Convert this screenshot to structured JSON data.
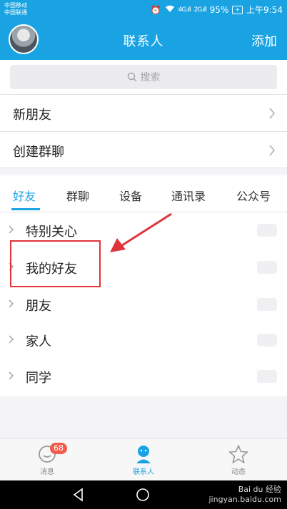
{
  "status_bar": {
    "carrier_1": "中国移动",
    "carrier_2": "中国联通",
    "signal_1": "4G.ıll",
    "signal_2": "2G.ıll",
    "battery": "95%",
    "time": "上午9:54"
  },
  "header": {
    "title": "联系人",
    "add_label": "添加"
  },
  "search": {
    "placeholder": "搜索"
  },
  "rows": [
    {
      "label": "新朋友"
    },
    {
      "label": "创建群聊"
    }
  ],
  "tabs": [
    {
      "label": "好友",
      "active": true
    },
    {
      "label": "群聊"
    },
    {
      "label": "设备"
    },
    {
      "label": "通讯录"
    },
    {
      "label": "公众号"
    }
  ],
  "groups": [
    {
      "label": "特别关心"
    },
    {
      "label": "我的好友"
    },
    {
      "label": "朋友"
    },
    {
      "label": "家人"
    },
    {
      "label": "同学"
    }
  ],
  "bottom_nav": {
    "messages": {
      "label": "消息",
      "badge": "68"
    },
    "contacts": {
      "label": "联系人"
    },
    "feed": {
      "label": "动态"
    }
  },
  "watermark": {
    "brand": "Bai du 经验",
    "url": "jingyan.baidu.com"
  },
  "colors": {
    "accent": "#1aa3e3",
    "badge": "#f25a4a",
    "annotation": "#e0343a"
  }
}
